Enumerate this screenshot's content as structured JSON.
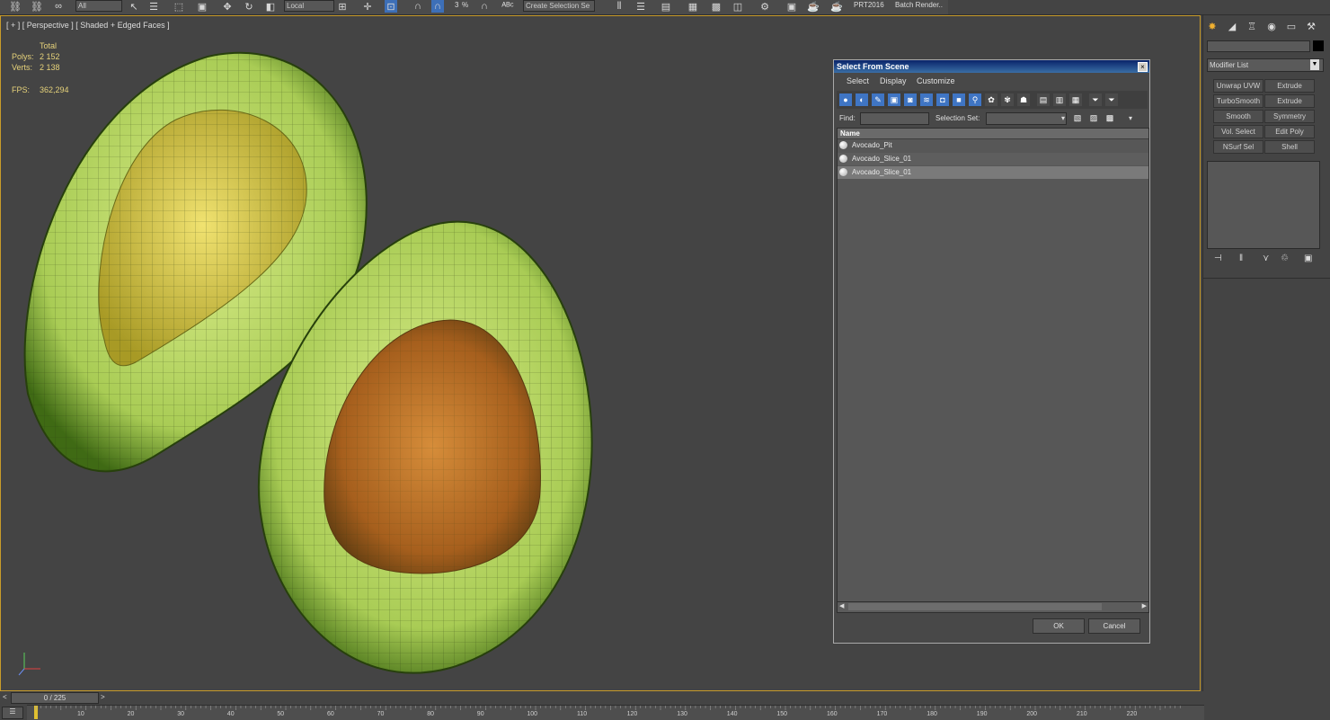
{
  "toolbar": {
    "filter_combo": "All",
    "coord_combo": "Local",
    "selection_set_combo": "Create Selection Se",
    "prt_label": "PRT2016",
    "batch_render_label": "Batch Render..",
    "snap_angle": "3",
    "snap_percent": "%"
  },
  "viewport": {
    "label": "[ + ] [ Perspective ] [ Shaded + Edged Faces ]",
    "stats_header": "Total",
    "polys_label": "Polys:",
    "polys_value": "2 152",
    "verts_label": "Verts:",
    "verts_value": "2 138",
    "fps_label": "FPS:",
    "fps_value": "362,294"
  },
  "command_panel": {
    "modifier_list": "Modifier List",
    "buttons": [
      "Unwrap UVW",
      "Extrude",
      "TurboSmooth",
      "Extrude",
      "Smooth",
      "Symmetry",
      "Vol. Select",
      "Edit Poly",
      "NSurf Sel",
      "Shell"
    ]
  },
  "dialog": {
    "title": "Select From Scene",
    "close": "×",
    "menu": [
      "Select",
      "Display",
      "Customize"
    ],
    "find_label": "Find:",
    "selection_set_label": "Selection Set:",
    "column_name": "Name",
    "items": [
      "Avocado_Pit",
      "Avocado_Slice_01",
      "Avocado_Slice_01"
    ],
    "ok": "OK",
    "cancel": "Cancel"
  },
  "timeline": {
    "frame_display": "0 / 225",
    "prev": "<",
    "next": ">",
    "ticks": [
      "10",
      "20",
      "30",
      "40",
      "50",
      "60",
      "70",
      "80",
      "90",
      "100",
      "110",
      "120",
      "130",
      "140",
      "150",
      "160",
      "170",
      "180",
      "190",
      "200",
      "210",
      "220"
    ]
  },
  "colors": {
    "viewport_border": "#c89b2a",
    "selection_blue": "#3f75c4",
    "stats_yellow": "#e6d27a"
  }
}
